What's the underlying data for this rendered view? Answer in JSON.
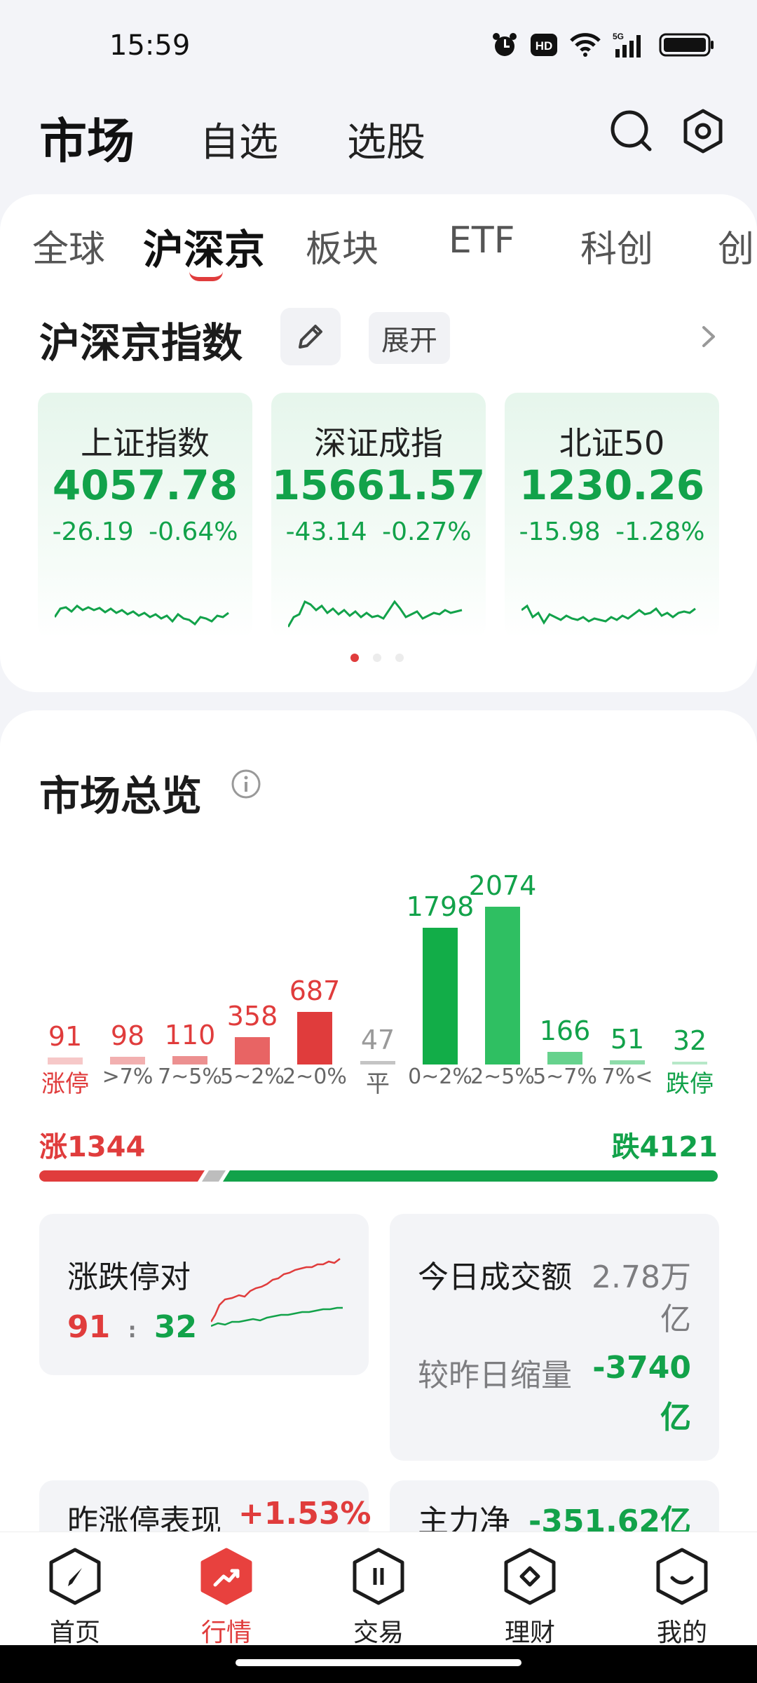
{
  "status_bar": {
    "time": "15:59",
    "hd": "HD",
    "net": "5G"
  },
  "header": {
    "title": "市场",
    "tab_watchlist": "自选",
    "tab_screener": "选股"
  },
  "market_tabs": [
    "全球",
    "沪深京",
    "板块",
    "ETF",
    "科创",
    "创"
  ],
  "index_section": {
    "title": "沪深京指数",
    "expand_label": "展开",
    "cards": [
      {
        "name": "上证指数",
        "price": "4057.78",
        "change": "-26.19",
        "pct": "-0.64%"
      },
      {
        "name": "深证成指",
        "price": "15661.57",
        "change": "-43.14",
        "pct": "-0.27%"
      },
      {
        "name": "北证50",
        "price": "1230.26",
        "change": "-15.98",
        "pct": "-1.28%"
      }
    ]
  },
  "overview": {
    "title": "市场总览",
    "chart_data": {
      "type": "bar",
      "categories": [
        "涨停",
        ">7%",
        "7~5%",
        "5~2%",
        "2~0%",
        "平",
        "0~2%",
        "2~5%",
        "5~7%",
        "7%<",
        "跌停"
      ],
      "values": [
        91,
        98,
        110,
        358,
        687,
        47,
        1798,
        2074,
        166,
        51,
        32
      ]
    },
    "rise_label": "涨1344",
    "fall_label": "跌4121",
    "limit_pair": {
      "title": "涨跌停对",
      "up": "91",
      "sep": ":",
      "down": "32"
    },
    "turnover": {
      "title": "今日成交额",
      "value_1": "2.78万",
      "value_2": "亿",
      "cmp_label": "较昨日缩量",
      "cmp_value_1": "-3740",
      "cmp_value_2": "亿"
    },
    "yesterday_limit": {
      "title": "昨涨停表现",
      "value": "+1.53%"
    },
    "main_flow": {
      "title": "主力净",
      "value": "-351.62亿"
    }
  },
  "bottom_nav": [
    "首页",
    "行情",
    "交易",
    "理财",
    "我的"
  ],
  "colors": {
    "up": "#e03c3c",
    "down": "#12a24a",
    "flat": "#9a9a9a"
  }
}
